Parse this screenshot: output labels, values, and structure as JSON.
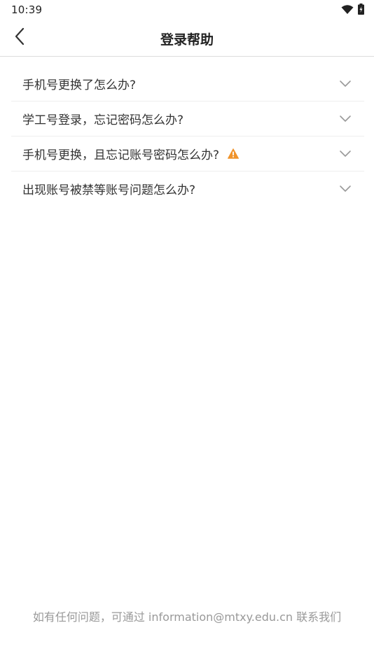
{
  "status_bar": {
    "time": "10:39",
    "wifi_icon": "wifi-icon",
    "battery_icon": "battery-charging-icon"
  },
  "header": {
    "back_icon": "chevron-left-icon",
    "title": "登录帮助"
  },
  "faq": {
    "items": [
      {
        "question": "手机号更换了怎么办?",
        "expand_icon": "chevron-down-icon"
      },
      {
        "question": "学工号登录，忘记密码怎么办?",
        "expand_icon": "chevron-down-icon"
      },
      {
        "question": "手机号更换，且忘记账号密码怎么办?",
        "badge_icon": "warning-icon",
        "expand_icon": "chevron-down-icon"
      },
      {
        "question": "出现账号被禁等账号问题怎么办?",
        "expand_icon": "chevron-down-icon"
      }
    ]
  },
  "footer": {
    "contact_text": "如有任何问题，可通过 information@mtxy.edu.cn 联系我们"
  },
  "colors": {
    "warning": "#f0932b",
    "divider": "#dcdcdc",
    "text_primary": "#333333",
    "text_muted": "#999999"
  }
}
